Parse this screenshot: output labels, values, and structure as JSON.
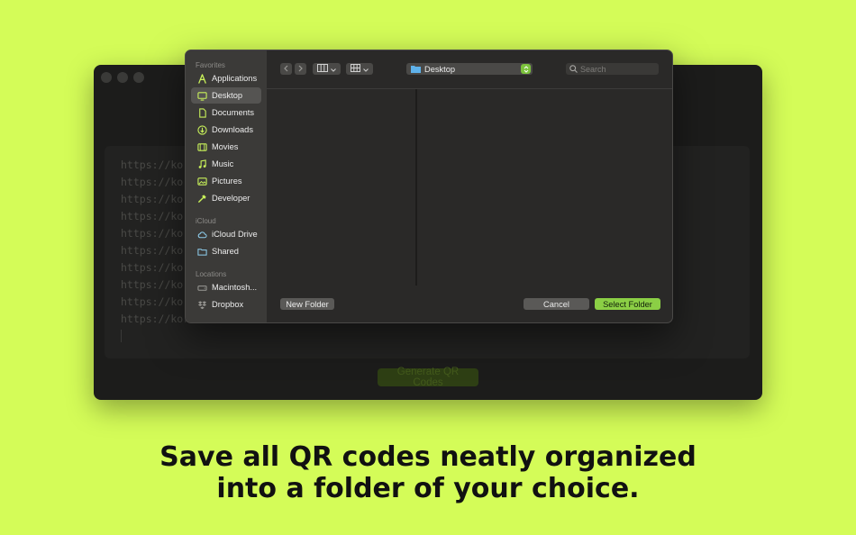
{
  "background_color": "#d4fc58",
  "accent_color": "#8bcf45",
  "app": {
    "urls": [
      "https://kor",
      "https://kor",
      "https://kor",
      "https://kor",
      "https://kor",
      "https://kor",
      "https://kor",
      "https://kor",
      "https://kor",
      "https://kor"
    ],
    "generate_label": "Generate QR Codes"
  },
  "dialog": {
    "sidebar": {
      "favorites_header": "Favorites",
      "icloud_header": "iCloud",
      "locations_header": "Locations",
      "favorites": [
        {
          "label": "Applications",
          "icon": "applications-icon"
        },
        {
          "label": "Desktop",
          "icon": "desktop-icon",
          "selected": true
        },
        {
          "label": "Documents",
          "icon": "document-icon"
        },
        {
          "label": "Downloads",
          "icon": "download-icon"
        },
        {
          "label": "Movies",
          "icon": "film-icon"
        },
        {
          "label": "Music",
          "icon": "music-note-icon"
        },
        {
          "label": "Pictures",
          "icon": "photo-icon"
        },
        {
          "label": "Developer",
          "icon": "hammer-icon"
        }
      ],
      "icloud": [
        {
          "label": "iCloud Drive",
          "icon": "cloud-icon"
        },
        {
          "label": "Shared",
          "icon": "shared-folder-icon"
        }
      ],
      "locations": [
        {
          "label": "Macintosh...",
          "icon": "disk-icon"
        },
        {
          "label": "Dropbox",
          "icon": "dropbox-icon"
        }
      ]
    },
    "toolbar": {
      "back_icon": "chevron-left-icon",
      "forward_icon": "chevron-right-icon",
      "view_mode_icon": "columns-view-icon",
      "group_icon": "grid-view-icon",
      "path_label": "Desktop",
      "search_placeholder": "Search"
    },
    "footer": {
      "new_folder_label": "New Folder",
      "cancel_label": "Cancel",
      "select_folder_label": "Select Folder"
    }
  },
  "caption": {
    "line1": "Save all QR codes neatly organized",
    "line2": "into a folder of your choice."
  }
}
